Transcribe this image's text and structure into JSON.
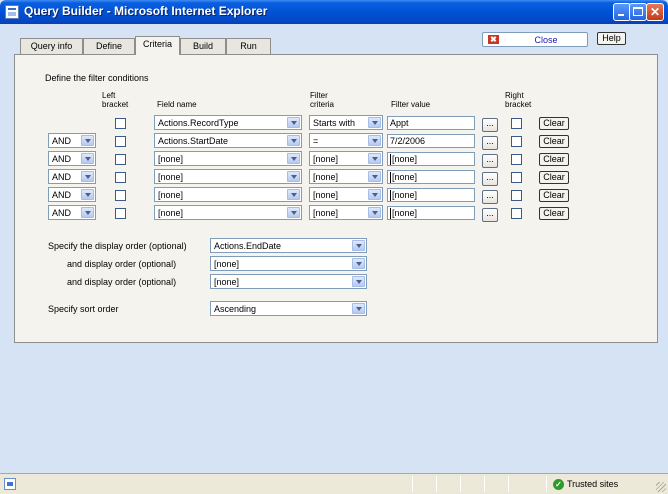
{
  "window": {
    "title": "Query Builder - Microsoft Internet Explorer",
    "minimize_glyph": "",
    "maximize_glyph": "",
    "close_glyph": "✕"
  },
  "tabs": [
    {
      "label": "Query info",
      "active": false
    },
    {
      "label": "Define",
      "active": false
    },
    {
      "label": "Criteria",
      "active": true
    },
    {
      "label": "Build",
      "active": false
    },
    {
      "label": "Run",
      "active": false
    }
  ],
  "toolbar": {
    "close_label": "Close",
    "close_icon": "✖",
    "help_label": "Help"
  },
  "criteria": {
    "section_title": "Define the filter conditions",
    "headers": {
      "left_bracket": "Left bracket",
      "field_name": "Field name",
      "filter_criteria": "Filter criteria",
      "filter_value": "Filter value",
      "right_bracket": "Right bracket"
    },
    "browse_label": "...",
    "clear_label": "Clear",
    "rows": [
      {
        "connector": "",
        "field": "Actions.RecordType",
        "criteria": "Starts with",
        "value": "Appt"
      },
      {
        "connector": "AND",
        "field": "Actions.StartDate",
        "criteria": "=",
        "value": "7/2/2006"
      },
      {
        "connector": "AND",
        "field": "[none]",
        "criteria": "[none]",
        "value": "[none]"
      },
      {
        "connector": "AND",
        "field": "[none]",
        "criteria": "[none]",
        "value": "[none]"
      },
      {
        "connector": "AND",
        "field": "[none]",
        "criteria": "[none]",
        "value": "[none]"
      },
      {
        "connector": "AND",
        "field": "[none]",
        "criteria": "[none]",
        "value": "[none]"
      }
    ]
  },
  "display_order": {
    "primary_label": "Specify the display order (optional)",
    "primary_value": "Actions.EndDate",
    "secondary_label": "and display order (optional)",
    "secondary_value": "[none]",
    "tertiary_label": "and display order (optional)",
    "tertiary_value": "[none]"
  },
  "sort_order": {
    "label": "Specify sort order",
    "value": "Ascending"
  },
  "statusbar": {
    "zone_text": "Trusted sites",
    "trust_icon": "✓"
  }
}
